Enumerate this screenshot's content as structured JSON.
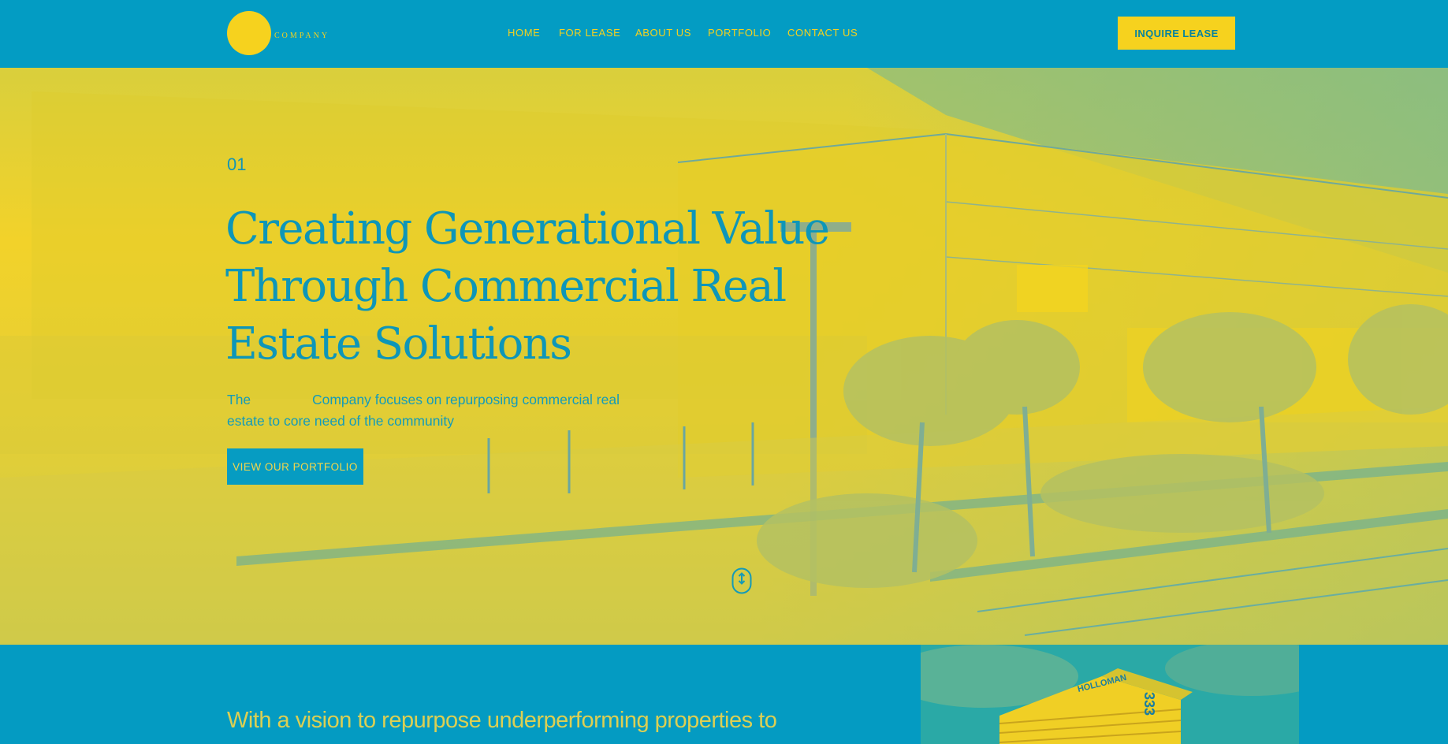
{
  "header": {
    "logo_text": "COMPANY",
    "nav": [
      "HOME",
      "FOR LEASE",
      "ABOUT US",
      "PORTFOLIO",
      "CONTACT US"
    ],
    "cta_label": "INQUIRE LEASE"
  },
  "hero": {
    "number": "01",
    "title_lines": [
      "Creating Generational Value",
      "Through Commercial Real",
      "Estate Solutions"
    ],
    "description_lines": [
      "The                Company focuses on repurposing commercial real",
      "estate to core need of the community"
    ],
    "button_label": "VIEW OUR PORTFOLIO"
  },
  "lower": {
    "heading": "With a vision to repurpose underperforming properties to",
    "building_sign": "HOLLOMAN",
    "building_number": "333"
  },
  "colors": {
    "primary_blue": "#039cc3",
    "accent_yellow": "#f6d21e"
  }
}
